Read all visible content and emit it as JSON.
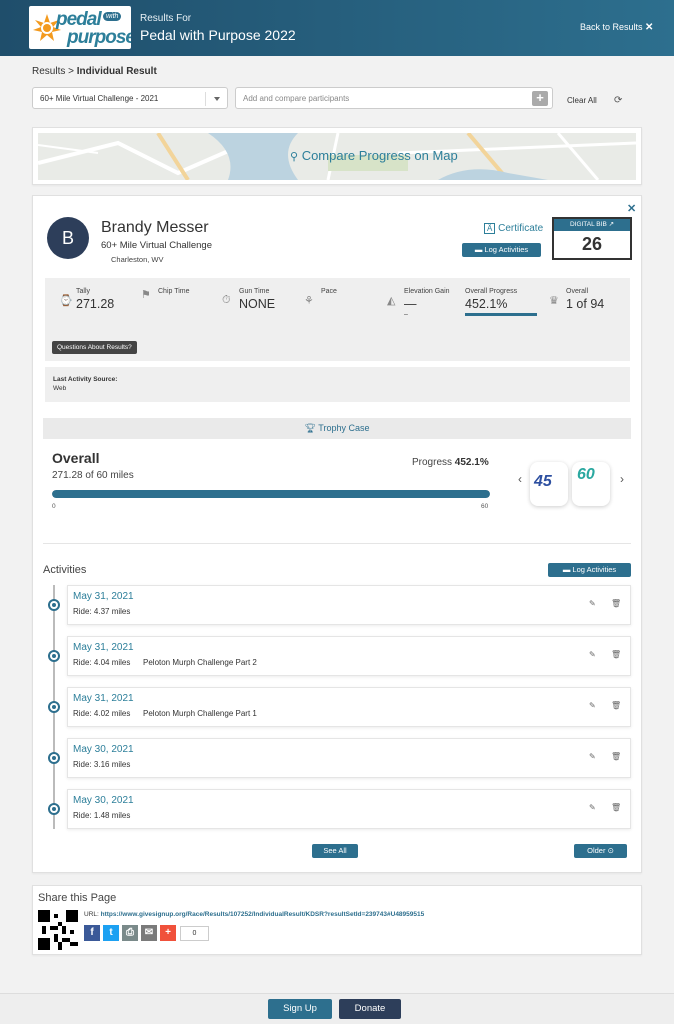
{
  "header": {
    "logo_text_1": "pedal",
    "logo_text_2": "purpose",
    "logo_with": "with",
    "subtitle": "Results For",
    "title": "Pedal with Purpose 2022",
    "back_label": "Back to Results",
    "back_icon": "close-icon"
  },
  "breadcrumb": {
    "root": "Results",
    "sep": " > ",
    "current": "Individual Result"
  },
  "filters": {
    "event_select": "60+ Mile Virtual Challenge - 2021",
    "compare_placeholder": "Add and compare participants",
    "clear_all": "Clear All"
  },
  "map": {
    "label": "Compare Progress on Map"
  },
  "participant": {
    "initial": "B",
    "name": "Brandy Messer",
    "event": "60+ Mile Virtual Challenge",
    "location": "Charleston, WV",
    "certificate": "Certificate",
    "log_activities": "Log Activities",
    "bib_label": "DIGITAL BIB",
    "bib_number": "26"
  },
  "stats": {
    "tally_label": "Tally",
    "tally_value": "271.28",
    "chip_label": "Chip Time",
    "gun_label": "Gun Time",
    "gun_value": "NONE",
    "pace_label": "Pace",
    "elev_label": "Elevation Gain",
    "elev_value": "—",
    "elev_sub": "–",
    "progress_label": "Overall Progress",
    "progress_value": "452.1%",
    "overall_label": "Overall",
    "overall_value": "1 of 94",
    "questions": "Questions About Results?"
  },
  "last_source": {
    "label": "Last Activity Source:",
    "value": "Web"
  },
  "trophy": {
    "label": "Trophy Case"
  },
  "overall": {
    "title": "Overall",
    "sub": "271.28 of 60 miles",
    "progress_label": "Progress",
    "progress_value": "452.1%",
    "bar_fraction": 1.0,
    "min": "0",
    "max": "60",
    "badge1": "45",
    "badge2": "60"
  },
  "activities": {
    "title": "Activities",
    "log_label": "Log Activities",
    "items": [
      {
        "date": "May 31, 2021",
        "ride": "Ride: 4.37 miles",
        "name": ""
      },
      {
        "date": "May 31, 2021",
        "ride": "Ride: 4.04 miles",
        "name": "Peloton Murph Challenge Part 2"
      },
      {
        "date": "May 31, 2021",
        "ride": "Ride: 4.02 miles",
        "name": "Peloton Murph Challenge Part 1"
      },
      {
        "date": "May 30, 2021",
        "ride": "Ride: 3.16 miles",
        "name": ""
      },
      {
        "date": "May 30, 2021",
        "ride": "Ride: 1.48 miles",
        "name": ""
      }
    ],
    "see_all": "See All",
    "older": "Older"
  },
  "share": {
    "title": "Share this Page",
    "url_label": "URL:",
    "url": "https://www.givesignup.org/Race/Results/107252/IndividualResult/KDSR?resultSetId=239743#U48959515",
    "count": "0"
  },
  "footer": {
    "signup": "Sign Up",
    "donate": "Donate"
  },
  "colors": {
    "primary": "#2d6f8e",
    "navy": "#2d3e5a",
    "header": "#1f4e6b"
  }
}
